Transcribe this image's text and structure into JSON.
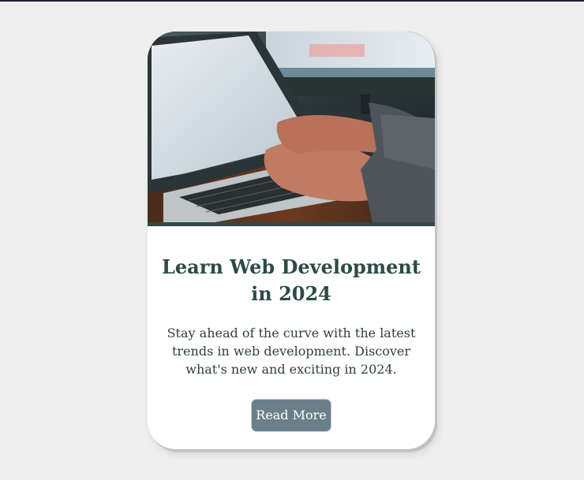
{
  "card": {
    "image": {
      "alt": "laptop-typing-photo"
    },
    "title": "Learn Web Development in 2024",
    "description": "Stay ahead of the curve with the latest trends in web development. Discover what's new and exciting in 2024.",
    "button_label": "Read More"
  },
  "colors": {
    "page_background": "#efefef",
    "top_border": "#1f1e3a",
    "card_background": "#ffffff",
    "title": "#2b4b47",
    "button_background": "#6a7f89",
    "button_text": "#ffffff"
  }
}
